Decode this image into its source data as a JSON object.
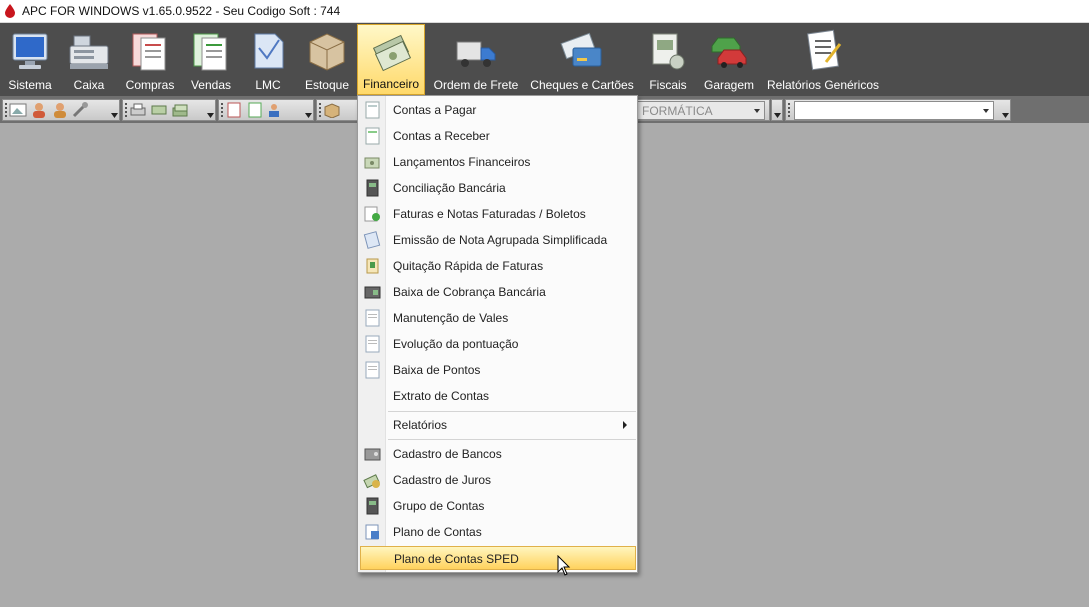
{
  "window": {
    "title": "APC FOR WINDOWS v1.65.0.9522 - Seu Codigo Soft : 744"
  },
  "ribbon": {
    "items": [
      {
        "label": "Sistema",
        "icon": "monitor-icon"
      },
      {
        "label": "Caixa",
        "icon": "cash-register-icon"
      },
      {
        "label": "Compras",
        "icon": "purchase-docs-icon"
      },
      {
        "label": "Vendas",
        "icon": "sales-docs-icon"
      },
      {
        "label": "LMC",
        "icon": "lmc-doc-icon"
      },
      {
        "label": "Estoque",
        "icon": "box-icon"
      },
      {
        "label": "Financeiro",
        "icon": "money-icon"
      },
      {
        "label": "Ordem de Frete",
        "icon": "truck-icon"
      },
      {
        "label": "Cheques e Cartões",
        "icon": "cheque-card-icon"
      },
      {
        "label": "Fiscais",
        "icon": "fiscal-docs-icon"
      },
      {
        "label": "Garagem",
        "icon": "cars-icon"
      },
      {
        "label": "Relatórios Genéricos",
        "icon": "report-icon"
      }
    ],
    "active": "Financeiro"
  },
  "toolbar": {
    "combo1_value": "FORMÁTICA",
    "combo2_value": ""
  },
  "menu": {
    "group1": [
      {
        "label": "Contas a Pagar",
        "icon": "payable-icon"
      },
      {
        "label": "Contas a Receber",
        "icon": "receivable-icon"
      },
      {
        "label": "Lançamentos Financeiros",
        "icon": "entries-icon"
      },
      {
        "label": "Conciliação Bancária",
        "icon": "bank-reconcile-icon"
      },
      {
        "label": "Faturas e Notas Faturadas / Boletos",
        "icon": "invoice-icon"
      },
      {
        "label": "Emissão de Nota Agrupada Simplificada",
        "icon": "grouped-note-icon"
      },
      {
        "label": "Quitação Rápida de Faturas",
        "icon": "quick-pay-icon"
      },
      {
        "label": "Baixa de Cobrança Bancária",
        "icon": "bank-collection-icon"
      },
      {
        "label": "Manutenção de Vales",
        "icon": "voucher-icon"
      },
      {
        "label": "Evolução da pontuação",
        "icon": "points-evolution-icon"
      },
      {
        "label": "Baixa de Pontos",
        "icon": "points-writeoff-icon"
      },
      {
        "label": "Extrato de Contas",
        "icon": ""
      }
    ],
    "relatorios": "Relatórios",
    "group2": [
      {
        "label": "Cadastro de Bancos",
        "icon": "bank-icon"
      },
      {
        "label": "Cadastro de Juros",
        "icon": "interest-icon"
      },
      {
        "label": "Grupo de Contas",
        "icon": "account-group-icon"
      },
      {
        "label": "Plano de Contas",
        "icon": "chart-of-accounts-icon"
      },
      {
        "label": "Plano de Contas SPED",
        "icon": ""
      }
    ],
    "highlighted": "Plano de Contas SPED"
  },
  "colors": {
    "ribbon_bg": "#4d4d4d",
    "highlight_top": "#fff6bf",
    "highlight_bottom": "#ffd25e",
    "workspace": "#ababab"
  }
}
